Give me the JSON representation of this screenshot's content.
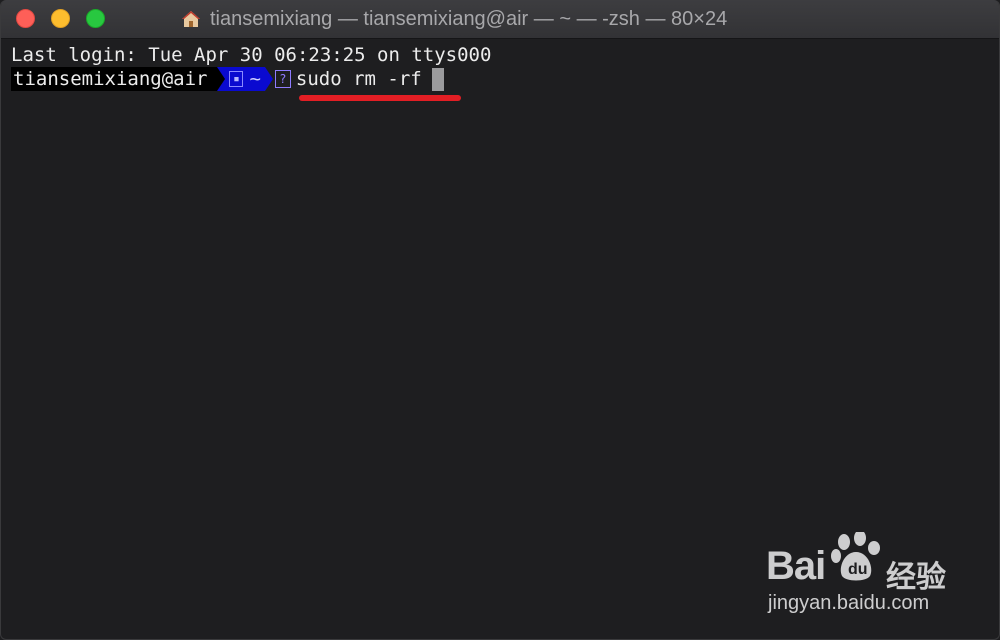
{
  "window": {
    "title": "tiansemixiang — tiansemixiang@air — ~ — -zsh — 80×24",
    "buttons": [
      "close",
      "minimize",
      "zoom"
    ]
  },
  "terminal": {
    "last_login": "Last login: Tue Apr 30 06:23:25 on ttys000",
    "prompt_user": "tiansemixiang@air",
    "prompt_dir": "~",
    "prompt_dir_icon": "folder-box-icon",
    "prompt_status_icon": "?",
    "command": "sudo rm -rf",
    "annotation_color": "#e21e24"
  },
  "watermark": {
    "brand": "Bai du",
    "brand_cn": "经验",
    "url": "jingyan.baidu.com"
  }
}
